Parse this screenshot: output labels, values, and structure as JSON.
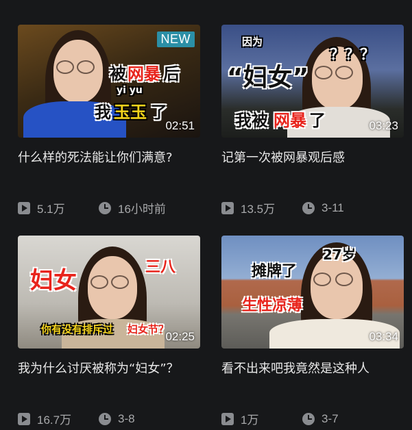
{
  "videos": [
    {
      "title": "什么样的死法能让你们满意?",
      "badge": "NEW",
      "duration": "02:51",
      "views": "5.1万",
      "time": "16小时前",
      "captions": [
        "被",
        "网暴",
        "后",
        "yi yu",
        "我",
        "玉玉",
        "了"
      ]
    },
    {
      "title": "记第一次被网暴观后感",
      "duration": "03:23",
      "views": "13.5万",
      "time": "3-11",
      "captions": [
        "因为",
        "“妇女”",
        "？？？",
        "我被",
        "网暴",
        "了"
      ]
    },
    {
      "title": "我为什么讨厌被称为“妇女”？",
      "duration": "02:25",
      "views": "16.7万",
      "time": "3-8",
      "captions": [
        "妇女",
        "三八",
        "你有没有排斥过",
        "妇女节？"
      ]
    },
    {
      "title": "看不出来吧我竟然是这种人",
      "duration": "03:34",
      "views": "1万",
      "time": "3-7",
      "captions": [
        "摊牌了",
        "27岁",
        "生性凉薄"
      ]
    }
  ],
  "icons": {
    "views": "play-count-icon",
    "time": "clock-icon"
  },
  "colors": {
    "background": "#17181a",
    "title_text": "#e8e8e8",
    "meta_text": "#a8a9ab",
    "badge_new": "#2b8fa6"
  }
}
